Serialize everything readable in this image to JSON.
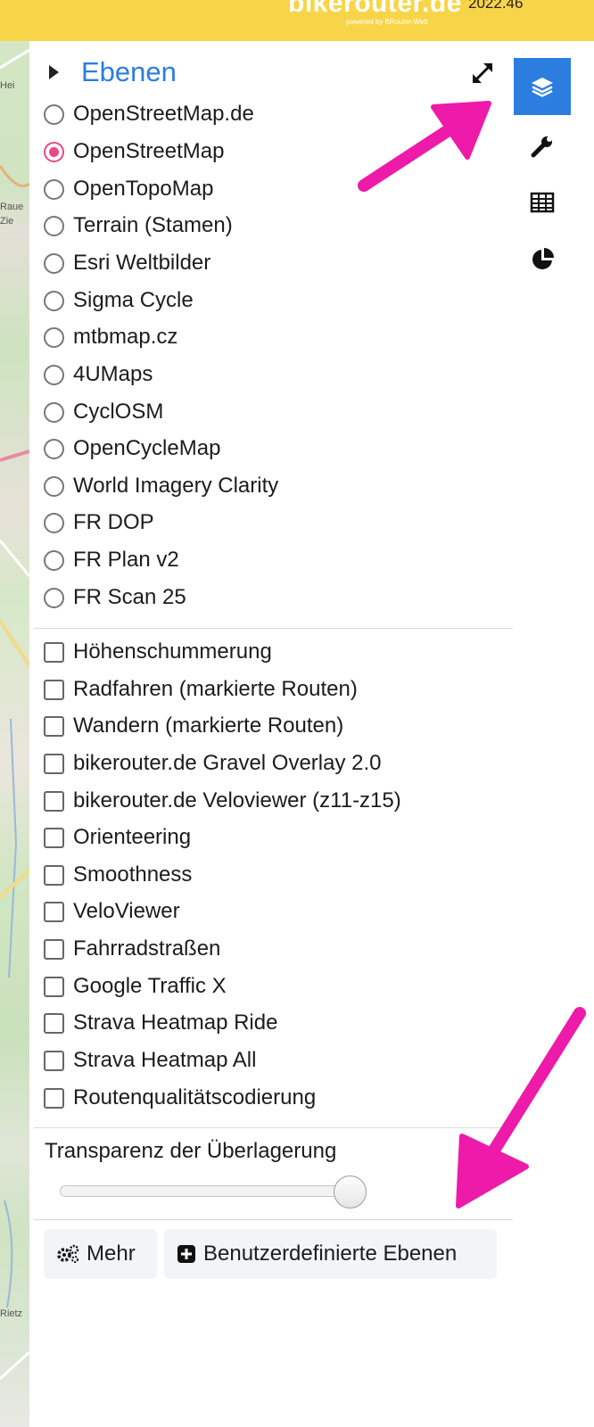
{
  "header": {
    "brand": "bikerouter.de",
    "brand_sub": "powered by BRouter-Web",
    "version": "2022.46"
  },
  "map": {
    "labels": [
      "Hei",
      "Raue",
      "Zie",
      "Rietz"
    ]
  },
  "layers_panel": {
    "title": "Ebenen",
    "base_layers": [
      {
        "label": "OpenStreetMap.de",
        "selected": false
      },
      {
        "label": "OpenStreetMap",
        "selected": true
      },
      {
        "label": "OpenTopoMap",
        "selected": false
      },
      {
        "label": "Terrain (Stamen)",
        "selected": false
      },
      {
        "label": "Esri Weltbilder",
        "selected": false
      },
      {
        "label": "Sigma Cycle",
        "selected": false
      },
      {
        "label": "mtbmap.cz",
        "selected": false
      },
      {
        "label": "4UMaps",
        "selected": false
      },
      {
        "label": "CyclOSM",
        "selected": false
      },
      {
        "label": "OpenCycleMap",
        "selected": false
      },
      {
        "label": "World Imagery Clarity",
        "selected": false
      },
      {
        "label": "FR DOP",
        "selected": false
      },
      {
        "label": "FR Plan v2",
        "selected": false
      },
      {
        "label": "FR Scan 25",
        "selected": false
      }
    ],
    "overlays": [
      {
        "label": "Höhenschummerung",
        "checked": false
      },
      {
        "label": "Radfahren (markierte Routen)",
        "checked": false
      },
      {
        "label": "Wandern (markierte Routen)",
        "checked": false
      },
      {
        "label": "bikerouter.de Gravel Overlay 2.0",
        "checked": false
      },
      {
        "label": "bikerouter.de Veloviewer (z11-z15)",
        "checked": false
      },
      {
        "label": "Orienteering",
        "checked": false
      },
      {
        "label": "Smoothness",
        "checked": false
      },
      {
        "label": "VeloViewer",
        "checked": false
      },
      {
        "label": "Fahrradstraßen",
        "checked": false
      },
      {
        "label": "Google Traffic X",
        "checked": false
      },
      {
        "label": "Strava Heatmap Ride",
        "checked": false
      },
      {
        "label": "Strava Heatmap All",
        "checked": false
      },
      {
        "label": "Routenqualitätscodierung",
        "checked": false
      }
    ],
    "transparency_label": "Transparenz der Überlagerung",
    "transparency_value": 0.9,
    "more_button": "Mehr",
    "custom_layers_button": "Benutzerdefinierte Ebenen"
  },
  "sidebar_tabs": [
    {
      "name": "layers-icon",
      "active": true
    },
    {
      "name": "wrench-icon",
      "active": false
    },
    {
      "name": "table-icon",
      "active": false
    },
    {
      "name": "pie-chart-icon",
      "active": false
    }
  ],
  "colors": {
    "header_bg": "#f8d548",
    "accent_blue": "#2b7de0",
    "radio_selected": "#e34b86",
    "annotation_arrow": "#ee1aa9"
  }
}
